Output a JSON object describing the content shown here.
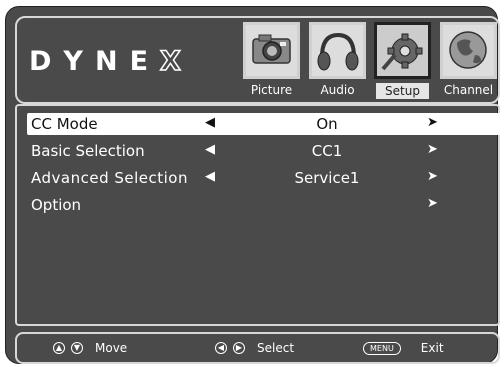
{
  "brand": {
    "letters": [
      "D",
      "Y",
      "N",
      "E",
      "X"
    ]
  },
  "tabs": [
    {
      "label": "Picture",
      "icon": "camera-icon",
      "active": false
    },
    {
      "label": "Audio",
      "icon": "headphones-icon",
      "active": false
    },
    {
      "label": "Setup",
      "icon": "gear-icon",
      "active": true
    },
    {
      "label": "Channel",
      "icon": "globe-icon",
      "active": false
    }
  ],
  "menu": [
    {
      "label": "CC Mode",
      "value": "On",
      "left_arrow": "◀",
      "right_arrow": "➤",
      "selected": true
    },
    {
      "label": "Basic Selection",
      "value": "CC1",
      "left_arrow": "◀",
      "right_arrow": "➤",
      "selected": false
    },
    {
      "label": "Advanced Selection",
      "value": "Service1",
      "left_arrow": "◀",
      "right_arrow": "➤",
      "selected": false
    },
    {
      "label": "Option",
      "value": "",
      "left_arrow": "",
      "right_arrow": "➤",
      "selected": false
    }
  ],
  "footer": {
    "move_label": "Move",
    "select_label": "Select",
    "menu_key": "MENU",
    "exit_label": "Exit"
  },
  "colors": {
    "panel": "#4a4a4a",
    "border": "#d8d8d8",
    "highlight": "#ffffff"
  }
}
